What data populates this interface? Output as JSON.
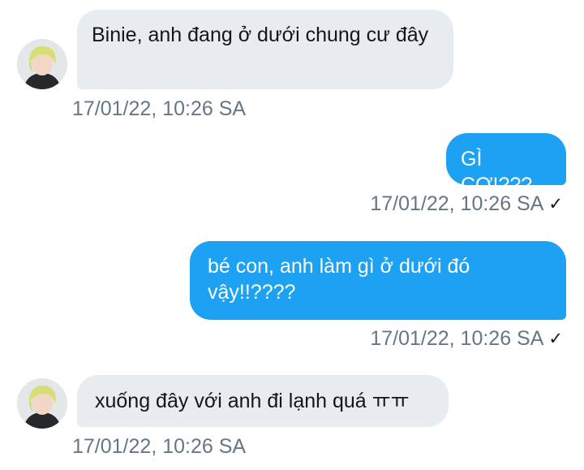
{
  "conversation": {
    "messages": [
      {
        "direction": "in",
        "text": "Binie, anh đang ở dưới chung cư đây",
        "timestamp": "17/01/22, 10:26 SA"
      },
      {
        "direction": "out",
        "text": "GÌ CƠ!???",
        "timestamp": "17/01/22, 10:26 SA",
        "read": true
      },
      {
        "direction": "out",
        "text": "bé con, anh làm gì ở dưới đó vậy!!????",
        "timestamp": "17/01/22, 10:26 SA",
        "read": true
      },
      {
        "direction": "in",
        "text": "xuống đây với anh đi lạnh quá ㅠㅠ",
        "timestamp": "17/01/22, 10:26 SA"
      }
    ]
  },
  "icons": {
    "check": "check-icon",
    "avatar": "avatar"
  },
  "colors": {
    "incoming_bubble": "#e6ecf0",
    "outgoing_bubble": "#1da1f2",
    "timestamp": "#657786"
  }
}
